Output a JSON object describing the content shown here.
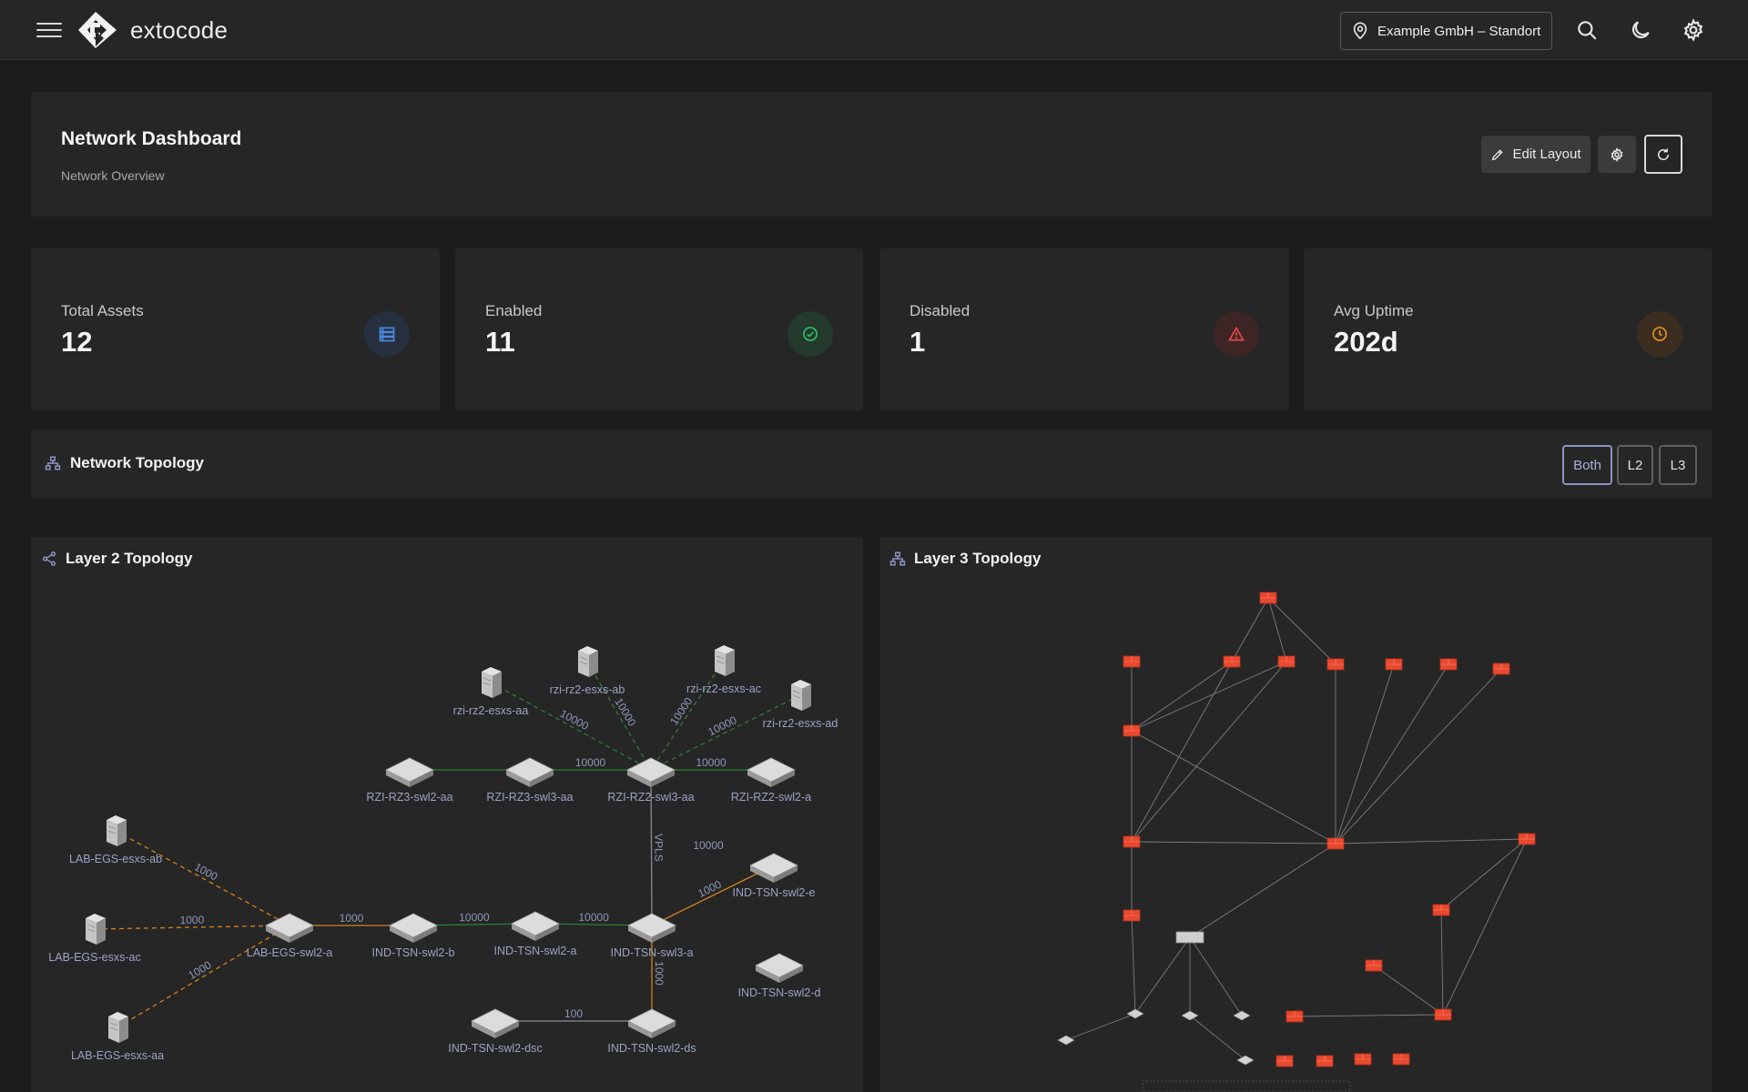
{
  "app": {
    "brand": "extocode",
    "site_selector": "Example GmbH – Standort"
  },
  "header": {
    "title": "Network Dashboard",
    "subtitle": "Network Overview",
    "edit_layout_label": "Edit Layout"
  },
  "stats": [
    {
      "label": "Total Assets",
      "value": "12",
      "icon": "server-icon",
      "color": "#4a8ae0"
    },
    {
      "label": "Enabled",
      "value": "11",
      "icon": "check-circle-icon",
      "color": "#2fbf6a"
    },
    {
      "label": "Disabled",
      "value": "1",
      "icon": "warning-triangle-icon",
      "color": "#e84a4a"
    },
    {
      "label": "Avg Uptime",
      "value": "202d",
      "icon": "clock-icon",
      "color": "#e89020"
    }
  ],
  "topology": {
    "title": "Network Topology",
    "view_options": [
      "Both",
      "L2",
      "L3"
    ],
    "selected_view": "Both"
  },
  "layer2": {
    "title": "Layer 2 Topology",
    "nodes": [
      {
        "id": "rzi-rz2-esxs-aa",
        "label": "rzi-rz2-esxs-aa",
        "kind": "server"
      },
      {
        "id": "rzi-rz2-esxs-ab",
        "label": "rzi-rz2-esxs-ab",
        "kind": "server"
      },
      {
        "id": "rzi-rz2-esxs-ac",
        "label": "rzi-rz2-esxs-ac",
        "kind": "server"
      },
      {
        "id": "rzi-rz2-esxs-ad",
        "label": "rzi-rz2-esxs-ad",
        "kind": "server"
      },
      {
        "id": "RZI-RZ3-swl2-aa",
        "label": "RZI-RZ3-swl2-aa",
        "kind": "switch"
      },
      {
        "id": "RZI-RZ3-swl3-aa",
        "label": "RZI-RZ3-swl3-aa",
        "kind": "switch"
      },
      {
        "id": "RZI-RZ2-swl3-aa",
        "label": "RZI-RZ2-swl3-aa",
        "kind": "switch"
      },
      {
        "id": "RZI-RZ2-swl2-a",
        "label": "RZI-RZ2-swl2-a",
        "kind": "switch"
      },
      {
        "id": "LAB-EGS-esxs-ab",
        "label": "LAB-EGS-esxs-ab",
        "kind": "server"
      },
      {
        "id": "LAB-EGS-esxs-ac",
        "label": "LAB-EGS-esxs-ac",
        "kind": "server"
      },
      {
        "id": "LAB-EGS-esxs-aa",
        "label": "LAB-EGS-esxs-aa",
        "kind": "server"
      },
      {
        "id": "LAB-EGS-swl2-a",
        "label": "LAB-EGS-swl2-a",
        "kind": "switch"
      },
      {
        "id": "IND-TSN-swl2-b",
        "label": "IND-TSN-swl2-b",
        "kind": "switch"
      },
      {
        "id": "IND-TSN-swl2-a",
        "label": "IND-TSN-swl2-a",
        "kind": "switch"
      },
      {
        "id": "IND-TSN-swl3-a",
        "label": "IND-TSN-swl3-a",
        "kind": "switch"
      },
      {
        "id": "IND-TSN-swl2-e",
        "label": "IND-TSN-swl2-e",
        "kind": "switch"
      },
      {
        "id": "IND-TSN-swl2-d",
        "label": "IND-TSN-swl2-d",
        "kind": "switch"
      },
      {
        "id": "IND-TSN-swl2-dsc",
        "label": "IND-TSN-swl2-dsc",
        "kind": "switch"
      },
      {
        "id": "IND-TSN-swl2-ds",
        "label": "IND-TSN-swl2-ds",
        "kind": "switch"
      }
    ],
    "links": [
      {
        "from": "rzi-rz2-esxs-aa",
        "to": "RZI-RZ2-swl3-aa",
        "label": "10000",
        "style": "green-dashed"
      },
      {
        "from": "rzi-rz2-esxs-ab",
        "to": "RZI-RZ2-swl3-aa",
        "label": "10000",
        "style": "green-dashed"
      },
      {
        "from": "rzi-rz2-esxs-ac",
        "to": "RZI-RZ2-swl3-aa",
        "label": "10000",
        "style": "green-dashed"
      },
      {
        "from": "rzi-rz2-esxs-ad",
        "to": "RZI-RZ2-swl3-aa",
        "label": "10000",
        "style": "green-dashed"
      },
      {
        "from": "RZI-RZ3-swl2-aa",
        "to": "RZI-RZ3-swl3-aa",
        "label": "",
        "style": "green"
      },
      {
        "from": "RZI-RZ3-swl3-aa",
        "to": "RZI-RZ2-swl3-aa",
        "label": "10000",
        "style": "green"
      },
      {
        "from": "RZI-RZ2-swl3-aa",
        "to": "RZI-RZ2-swl2-a",
        "label": "10000",
        "style": "green"
      },
      {
        "from": "RZI-RZ2-swl3-aa",
        "to": "IND-TSN-swl3-a",
        "label": "VPLS",
        "style": "gray"
      },
      {
        "from": "LAB-EGS-esxs-ab",
        "to": "LAB-EGS-swl2-a",
        "label": "1000",
        "style": "orange-dashed"
      },
      {
        "from": "LAB-EGS-esxs-ac",
        "to": "LAB-EGS-swl2-a",
        "label": "1000",
        "style": "orange-dashed"
      },
      {
        "from": "LAB-EGS-esxs-aa",
        "to": "LAB-EGS-swl2-a",
        "label": "1000",
        "style": "orange-dashed"
      },
      {
        "from": "LAB-EGS-swl2-a",
        "to": "IND-TSN-swl2-b",
        "label": "1000",
        "style": "orange"
      },
      {
        "from": "IND-TSN-swl2-b",
        "to": "IND-TSN-swl2-a",
        "label": "10000",
        "style": "green"
      },
      {
        "from": "IND-TSN-swl2-a",
        "to": "IND-TSN-swl3-a",
        "label": "10000",
        "style": "green"
      },
      {
        "from": "IND-TSN-swl3-a",
        "to": "IND-TSN-swl2-e",
        "label": "1000",
        "style": "orange"
      },
      {
        "from": "IND-TSN-swl3-a",
        "to": "IND-TSN-swl2-ds",
        "label": "1000",
        "style": "orange"
      },
      {
        "from": "IND-TSN-swl2-dsc",
        "to": "IND-TSN-swl2-ds",
        "label": "100",
        "style": "gray"
      }
    ],
    "floating_labels": [
      "10000"
    ]
  },
  "layer3": {
    "title": "Layer 3 Topology"
  }
}
